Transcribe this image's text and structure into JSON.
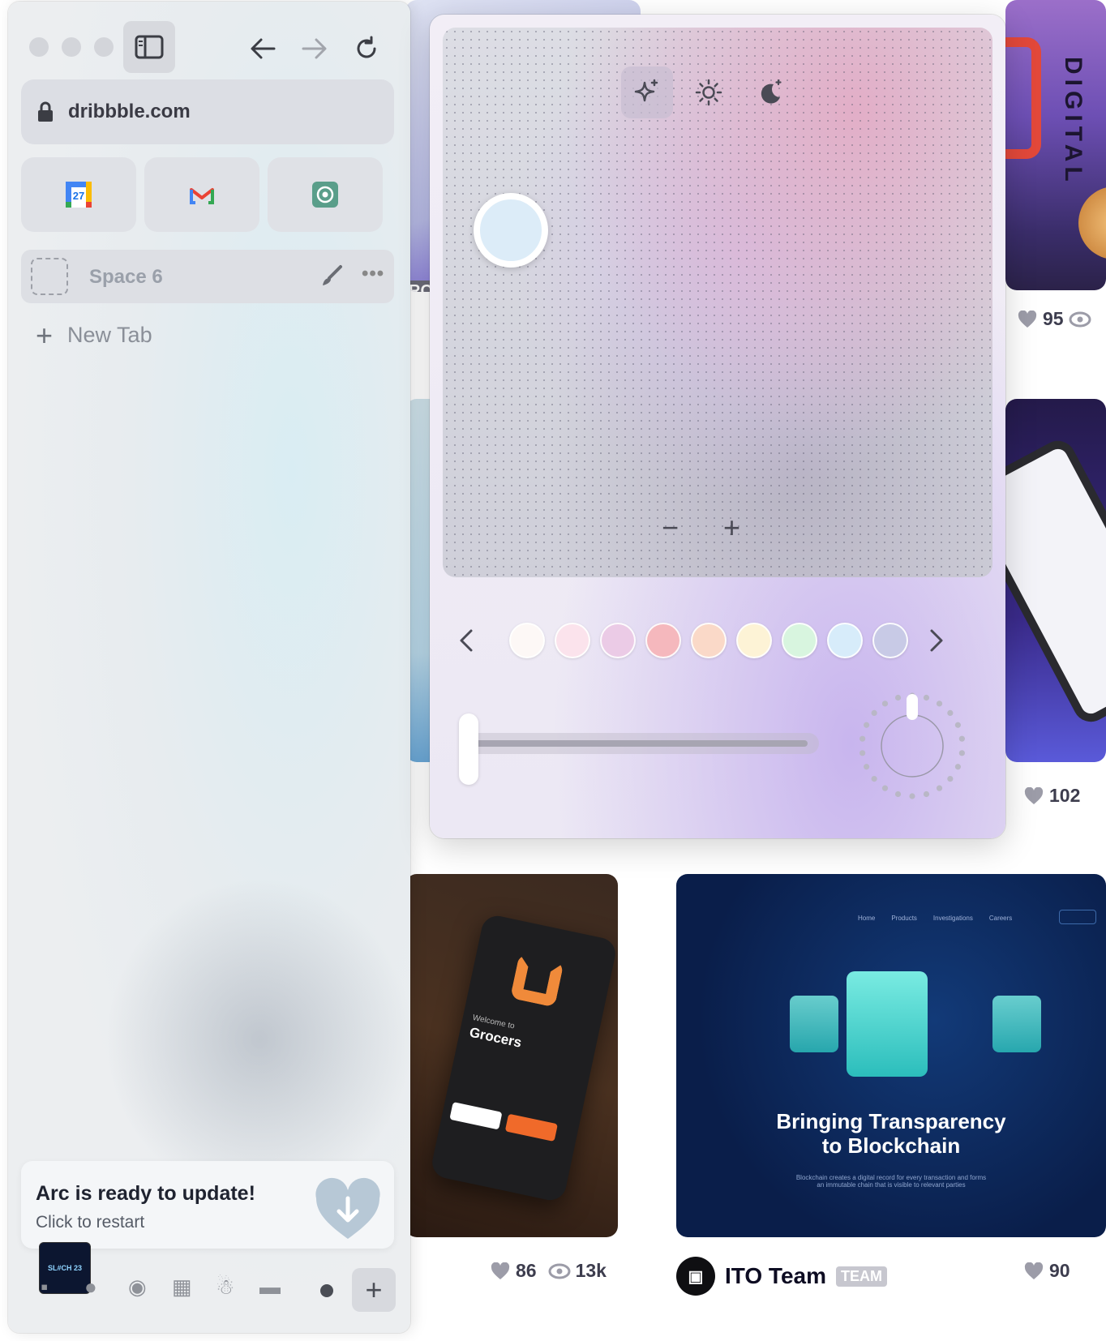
{
  "sidebar": {
    "url": "dribbble.com",
    "favorites": [
      {
        "name": "calendar",
        "day": "27"
      },
      {
        "name": "gmail",
        "glyph": "M"
      },
      {
        "name": "chatgpt",
        "glyph": "⌬"
      }
    ],
    "space_label": "Space 6",
    "more_label": "•••",
    "new_tab_label": "New Tab",
    "update_title": "Arc is ready to update!",
    "update_subtitle": "Click to restart",
    "thumb_text": "SL#CH 23",
    "dock_add": "+"
  },
  "popup": {
    "modes": [
      "auto",
      "light",
      "dark"
    ],
    "intensity_minus": "−",
    "intensity_plus": "+",
    "swatches": [
      "#fdf8f6",
      "#fbe3ec",
      "#ebcbe6",
      "#f5b8bd",
      "#fad9c8",
      "#fdf3d6",
      "#d8f5df",
      "#d7ecfa",
      "#c8cae6"
    ],
    "selected_color": "#dcecf8"
  },
  "feed": {
    "shot_tl_caption": "RO",
    "shot_tr_text": "DIGITAL",
    "stats_top_likes": "95",
    "stats_mid_likes": "102",
    "grocers_welcome": "Welcome to",
    "grocers_title": "Grocers",
    "bl_likes": "86",
    "bl_views": "13k",
    "br_nav": [
      "Home",
      "Products",
      "Investigations",
      "Careers"
    ],
    "br_title_1": "Bringing Transparency",
    "br_title_2": "to Blockchain",
    "br_desc_1": "Blockchain creates a digital record for every transaction and forms",
    "br_desc_2": "an immutable chain that is visible to relevant parties",
    "team_name": "ITO Team",
    "team_badge": "TEAM",
    "br_likes": "90"
  }
}
